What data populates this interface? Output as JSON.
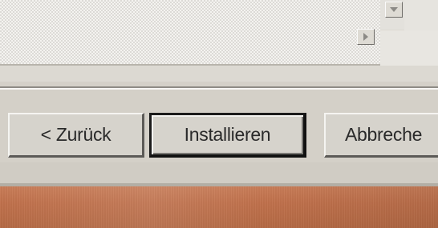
{
  "buttons": {
    "back_label": "< Zurück",
    "install_label": "Installieren",
    "cancel_label": "Abbreche"
  },
  "icons": {
    "scroll_down": "chevron-down-icon",
    "scroll_right": "chevron-right-icon"
  },
  "colors": {
    "dialog_face": "#d4d0c8",
    "desktop": "#c0714c",
    "default_button_border": "#1c1c1c"
  }
}
